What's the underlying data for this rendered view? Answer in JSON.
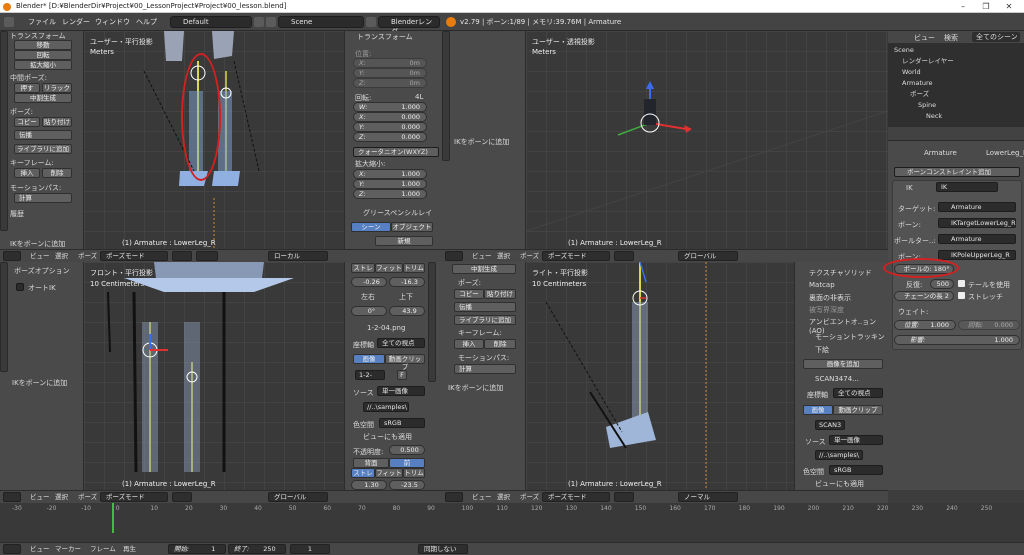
{
  "titlebar": {
    "title": "Blender* [D:¥BlenderDir¥Project¥00_LessonProject¥Project¥00_lesson.blend]",
    "min": "–",
    "max": "❐",
    "close": "✕"
  },
  "infobar": {
    "menus": [
      "ファイル",
      "レンダー",
      "ウィンドウ",
      "ヘルプ"
    ],
    "layout": "Default",
    "scene": "Scene",
    "engine": "Blenderレンダー",
    "stats": "v2.79 | ボーン:1/89 | メモリ:39.76M | Armature"
  },
  "tl_viewport": {
    "title": "ユーザー・平行投影",
    "units": "Meters",
    "status": "(1) Armature : LowerLeg_R"
  },
  "tr_viewport": {
    "title": "ユーザー・透視投影",
    "units": "Meters",
    "status": "(1) Armature : LowerLeg_R"
  },
  "bl_viewport": {
    "title": "フロント・平行投影",
    "units": "10 Centimeters",
    "status": "(1) Armature : LowerLeg_R"
  },
  "br_viewport": {
    "title": "ライト・平行投影",
    "units": "10 Centimeters",
    "status": "(1) Armature : LowerLeg_R"
  },
  "toolshelf_top": {
    "header": "トランスフォーム",
    "move": "移動",
    "rotate": "回転",
    "scale": "拡大縮小",
    "interp_label": "中間ポーズ:",
    "push": "押す",
    "relax": "リラックス",
    "breakdown": "中割生成",
    "pose_label": "ポーズ:",
    "copy": "コピー",
    "paste": "貼り付け",
    "propagate": "伝播",
    "add_library": "ライブラリに追加",
    "keyframe_label": "キーフレーム:",
    "insert": "挿入",
    "delete": "削除",
    "motionpath_label": "モーションパス:",
    "calculate": "計算",
    "history": "履歴",
    "ik_add": "IKをボーンに追加"
  },
  "npanel_top": {
    "header": "トランスフォーム",
    "location_label": "位置:",
    "loc": [
      {
        "axis": "X:",
        "val": "0m"
      },
      {
        "axis": "Y:",
        "val": "0m"
      },
      {
        "axis": "Z:",
        "val": "0m"
      }
    ],
    "rotation_label": "回転:",
    "rot_mode_short": "4L",
    "rot": [
      {
        "axis": "W:",
        "val": "1.000"
      },
      {
        "axis": "X:",
        "val": "0.000"
      },
      {
        "axis": "Y:",
        "val": "0.000"
      },
      {
        "axis": "Z:",
        "val": "0.000"
      }
    ],
    "rot_mode": "クォータニオン(WXYZ)",
    "scale_label": "拡大縮小:",
    "scale": [
      {
        "axis": "X:",
        "val": "1.000"
      },
      {
        "axis": "Y:",
        "val": "1.000"
      },
      {
        "axis": "Z:",
        "val": "1.000"
      }
    ],
    "gp_header": "グリースペンシルレイ",
    "scene_tab": "シーン",
    "object_tab": "オブジェクト",
    "new": "新規",
    "ik_add": "IKをボーンに追加"
  },
  "top_headers": {
    "left": {
      "view": "ビュー",
      "select": "選択",
      "pose": "ポーズ",
      "mode": "ポーズモード",
      "orient": "ローカル"
    },
    "right": {
      "view": "ビュー",
      "select": "選択",
      "pose": "ポーズ",
      "mode": "ポーズモード",
      "orient": "グローバル"
    }
  },
  "bl_toolshelf": {
    "header": "ボーズオプション",
    "autoik": "オートIK",
    "ik_add": "IKをボーンに追加"
  },
  "bl_npanel": {
    "stretch": "ストレ",
    "fit": "フィット",
    "trim": "トリム",
    "offset1": "-0.26",
    "offset2": "-16.3",
    "lr": "左右",
    "tb": "上下",
    "angle1": "0°",
    "angle2": "43.9",
    "image_header": "1-2-04.png",
    "coord_label": "座標軸",
    "coord_val": "全ての視点",
    "image_btn": "画像",
    "movie_btn": "動画クリップ",
    "img_name": "1-2-",
    "frame_f": "F",
    "source_label": "ソース",
    "source_val": "単一画像",
    "path": "//..\\samples\\",
    "colorspace_label": "色空間",
    "colorspace_val": "sRGB",
    "view_transform": "ビューにも適用",
    "opacity_label": "不透明度:",
    "opacity_val": "0.500",
    "back": "背面",
    "front": "前",
    "stretch2": "ストレ",
    "fit2": "フィット",
    "trim2": "トリム",
    "offset3": "1.30",
    "offset4": "-23.5"
  },
  "br_toolshelf": {
    "breakdown": "中割生成",
    "pose_label": "ポーズ:",
    "copy": "コピー",
    "paste": "貼り付け",
    "propagate": "伝播",
    "add_library": "ライブラリに追加",
    "keyframe_label": "キーフレーム:",
    "insert": "挿入",
    "delete": "削除",
    "motionpath_label": "モーションパス:",
    "calculate": "計算",
    "ik_add": "IKをボーンに追加"
  },
  "br_npanel": {
    "texsolid": "テクスチャソリッド",
    "matcap": "Matcap",
    "backface": "裏面の非表示",
    "depth": "被写界深度",
    "ao": "アンビエントオ..ョン(AO)",
    "motion_tracking": "モーショントラッキン",
    "background": "下絵",
    "add_image": "画像を追加",
    "scan": "SCAN3474...",
    "coord_label": "座標軸",
    "coord_val": "全ての視点",
    "image_btn": "画像",
    "movie_btn": "動画クリップ",
    "img_name": "SCAN3",
    "source_label": "ソース",
    "source_val": "単一画像",
    "path": "//..\\samples\\",
    "colorspace_label": "色空間",
    "colorspace_val": "sRGB",
    "view_transform": "ビューにも適用"
  },
  "bottom_headers": {
    "left": {
      "view": "ビュー",
      "select": "選択",
      "pose": "ポーズ",
      "mode": "ポーズモード",
      "orient": "グローバル"
    },
    "right": {
      "view": "ビュー",
      "select": "選択",
      "pose": "ポーズ",
      "mode": "ポーズモード",
      "orient": "ノーマル"
    }
  },
  "outliner": {
    "view": "ビュー",
    "search": "検索",
    "filter": "全てのシーン",
    "items": [
      {
        "label": "Scene",
        "indent": 0
      },
      {
        "label": "レンダーレイヤー",
        "indent": 1
      },
      {
        "label": "World",
        "indent": 1
      },
      {
        "label": "Armature",
        "indent": 1
      },
      {
        "label": "ポーズ",
        "indent": 2
      },
      {
        "label": "Spine",
        "indent": 3
      },
      {
        "label": "Neck",
        "indent": 4
      }
    ]
  },
  "props": {
    "breadcrumb_obj": "Armature",
    "breadcrumb_bone": "LowerLeg_R",
    "add_constraint": "ボーンコンストレイント追加",
    "constraint_type": "IK",
    "constraint_name": "IK",
    "target_label": "ターゲット:",
    "target_val": "Armature",
    "bone_label": "ボーン:",
    "bone_val": "IKTargetLowerLeg_R",
    "pole_target_label": "ポールター..:",
    "pole_target_val": "Armature",
    "pole_bone_label": "ボーン:",
    "pole_bone_val": "IKPoleUpperLeg_R",
    "pole_angle": "ポールの: 180°",
    "iterations_label": "反復:",
    "iterations_val": "500",
    "use_tail": "テールを使用",
    "chain_length": "チェーンの長 2",
    "stretch": "ストレッチ",
    "weight_label": "ウェイト:",
    "position_label": "位置:",
    "position_val": "1.000",
    "rotation_label": "回転:",
    "rotation_val": "0.000",
    "influence_label": "影響:",
    "influence_val": "1.000"
  },
  "timeline": {
    "ticks": [
      "-30",
      "-20",
      "-10",
      "0",
      "10",
      "20",
      "30",
      "40",
      "50",
      "60",
      "70",
      "80",
      "90",
      "100",
      "110",
      "120",
      "130",
      "140",
      "150",
      "160",
      "170",
      "180",
      "190",
      "200",
      "210",
      "220",
      "230",
      "240",
      "250"
    ],
    "view": "ビュー",
    "marker": "マーカー",
    "frame": "フレーム",
    "playback": "再生",
    "start_label": "開始:",
    "start_val": "1",
    "end_label": "終了:",
    "end_val": "250",
    "current": "1",
    "sync": "同期しない"
  },
  "colors": {
    "accent_blue": "#5680c2",
    "highlight_red": "#d42020",
    "bone_yellow": "#d8d84a"
  }
}
